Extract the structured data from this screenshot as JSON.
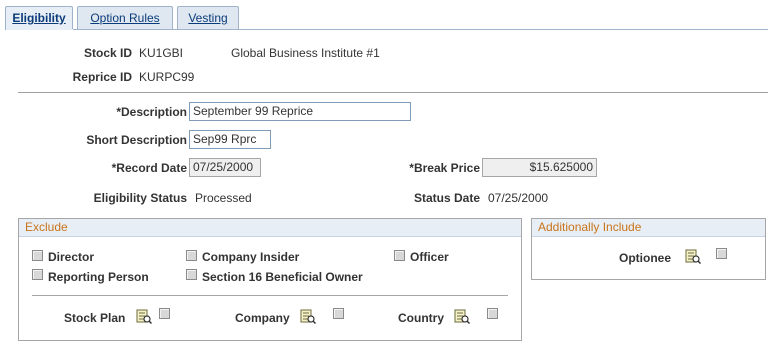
{
  "tabs": [
    {
      "label": "Eligibility",
      "active": true
    },
    {
      "label": "Option Rules",
      "active": false
    },
    {
      "label": "Vesting",
      "active": false
    }
  ],
  "header": {
    "stock_id_label": "Stock ID",
    "stock_id_value": "KU1GBI",
    "stock_name": "Global Business Institute #1",
    "reprice_id_label": "Reprice ID",
    "reprice_id_value": "KURPC99"
  },
  "form": {
    "description_label": "*Description",
    "description_value": "September 99 Reprice",
    "short_description_label": "Short Description",
    "short_description_value": "Sep99 Rprc",
    "record_date_label": "*Record Date",
    "record_date_value": "07/25/2000",
    "break_price_label": "*Break Price",
    "break_price_value": "$15.625000",
    "eligibility_status_label": "Eligibility Status",
    "eligibility_status_value": "Processed",
    "status_date_label": "Status Date",
    "status_date_value": "07/25/2000"
  },
  "exclude": {
    "title": "Exclude",
    "director": "Director",
    "company_insider": "Company Insider",
    "officer": "Officer",
    "reporting_person": "Reporting Person",
    "section16": "Section 16 Beneficial Owner",
    "stock_plan": "Stock Plan",
    "company": "Company",
    "country": "Country"
  },
  "additionally_include": {
    "title": "Additionally Include",
    "optionee": "Optionee"
  },
  "colors": {
    "group_title": "#c8741b",
    "tab_text": "#0b3b7a",
    "tab_bg": "#dfe8f1"
  }
}
